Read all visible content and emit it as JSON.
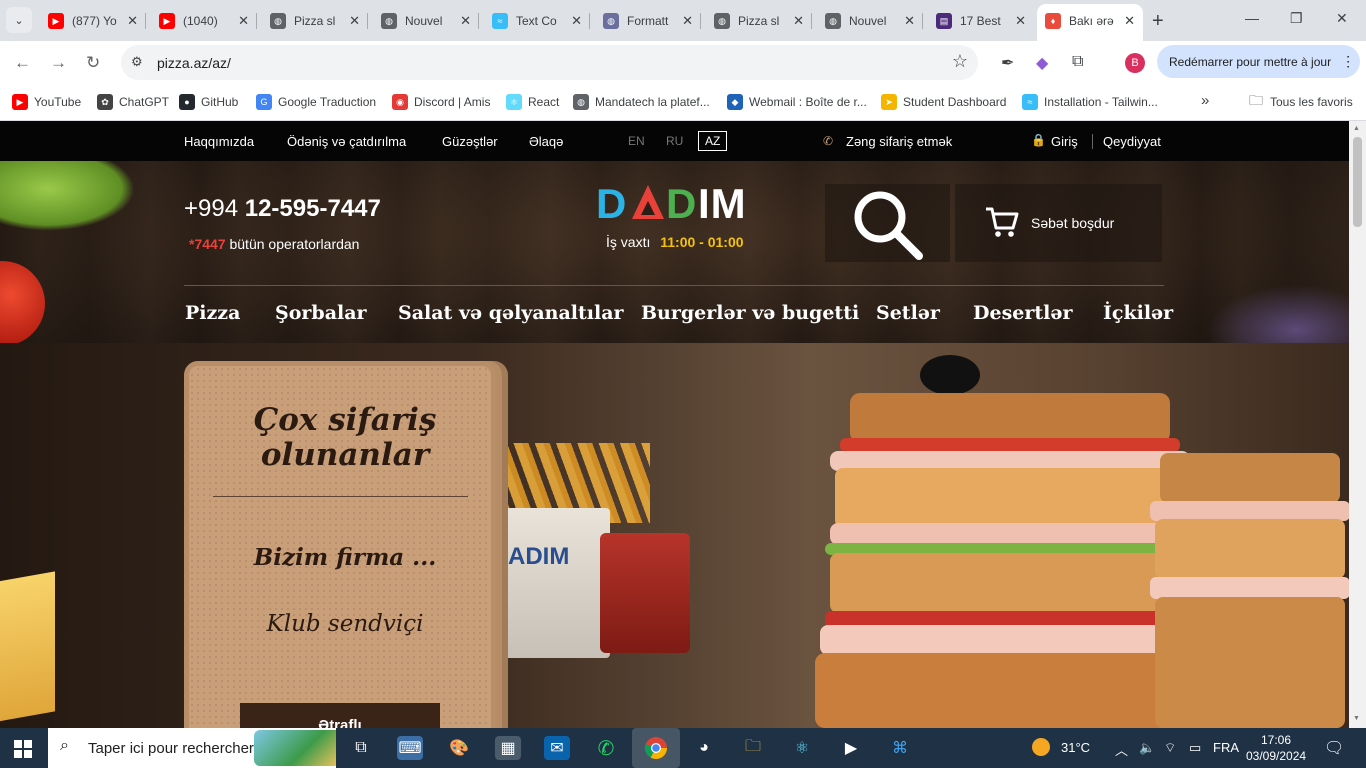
{
  "browser": {
    "tabs": [
      {
        "title": "(877) Yo",
        "fav_color": "#ff0000",
        "fav_glyph": "▶",
        "active": false
      },
      {
        "title": "(1040)",
        "fav_color": "#ff0000",
        "fav_glyph": "▶",
        "active": false
      },
      {
        "title": "Pizza sl",
        "fav_color": "#5f6368",
        "fav_glyph": "◍",
        "active": false
      },
      {
        "title": "Nouvel",
        "fav_color": "#5f6368",
        "fav_glyph": "◍",
        "active": false
      },
      {
        "title": "Text Co",
        "fav_color": "#38bdf8",
        "fav_glyph": "≈",
        "active": false
      },
      {
        "title": "Formatt",
        "fav_color": "#6b6f9e",
        "fav_glyph": "◍",
        "active": false
      },
      {
        "title": "Pizza sl",
        "fav_color": "#5f6368",
        "fav_glyph": "◍",
        "active": false
      },
      {
        "title": "Nouvel",
        "fav_color": "#5f6368",
        "fav_glyph": "◍",
        "active": false
      },
      {
        "title": "17 Best",
        "fav_color": "#4b2a7b",
        "fav_glyph": "▤",
        "active": false
      },
      {
        "title": "Bakı ərə",
        "fav_color": "#e94b3c",
        "fav_glyph": "♦",
        "active": true
      }
    ],
    "close_glyph": "✕",
    "new_tab_glyph": "+",
    "url": "pizza.az/az/",
    "profile_initial": "B",
    "relaunch_label": "Redémarrer pour mettre à jour",
    "bookmarks": [
      {
        "label": "YouTube",
        "color": "#ff0000",
        "glyph": "▶"
      },
      {
        "label": "ChatGPT",
        "color": "#444444",
        "glyph": "✿"
      },
      {
        "label": "GitHub",
        "color": "#24292f",
        "glyph": "●"
      },
      {
        "label": "Google Traduction",
        "color": "#4285f4",
        "glyph": "G"
      },
      {
        "label": "Discord | Amis",
        "color": "#e53935",
        "glyph": "◉"
      },
      {
        "label": "React",
        "color": "#61dafb",
        "glyph": "⚛"
      },
      {
        "label": "Mandatech la platef...",
        "color": "#5f6368",
        "glyph": "◍"
      },
      {
        "label": "Webmail : Boîte de r...",
        "color": "#1e63b8",
        "glyph": "◆"
      },
      {
        "label": "Student Dashboard",
        "color": "#f5b400",
        "glyph": "➤"
      },
      {
        "label": "Installation - Tailwin...",
        "color": "#38bdf8",
        "glyph": "≈"
      }
    ],
    "bookmarks_more": "»",
    "all_bookmarks_label": "Tous les favoris"
  },
  "site": {
    "topnav": {
      "links": [
        "Haqqımızda",
        "Ödəniş və çatdırılma",
        "Güzəştlər",
        "Əlaqə"
      ],
      "langs": [
        "EN",
        "RU",
        "AZ"
      ],
      "selected_lang": "AZ",
      "call_order": "Zəng sifariş etmək",
      "login": "Giriş",
      "register": "Qeydiyyat"
    },
    "phone_prefix": "+994",
    "phone_number": "12-595-7447",
    "short_number": "*7447",
    "operators_text": "bütün operatorlardan",
    "logo": "DADIM",
    "hours_label": "İş vaxtı",
    "hours_value": "11:00 - 01:00",
    "cart_label": "Səbət boşdur",
    "menu": [
      "Pizza",
      "Şorbalar",
      "Salat və qəlyanaltılar",
      "Burgerlər və bugetti",
      "Setlər",
      "Desertlər",
      "İçkilər"
    ],
    "card": {
      "title_line1": "Çox sifariş",
      "title_line2": "olunanlar",
      "subtitle": "Bizim firma ...",
      "item": "Klub sendviçi",
      "button": "Ətraflı"
    },
    "cup_logo": "ADIM"
  },
  "taskbar": {
    "search_placeholder": "Taper ici pour rechercher",
    "temperature": "31°C",
    "language": "FRA",
    "time": "17:06",
    "date": "03/09/2024"
  },
  "colors": {
    "accent_yellow": "#f4c20d",
    "accent_red": "#e8413a",
    "logo_blue": "#2bb3e6",
    "logo_red": "#e8413a",
    "logo_green": "#4caf50"
  }
}
